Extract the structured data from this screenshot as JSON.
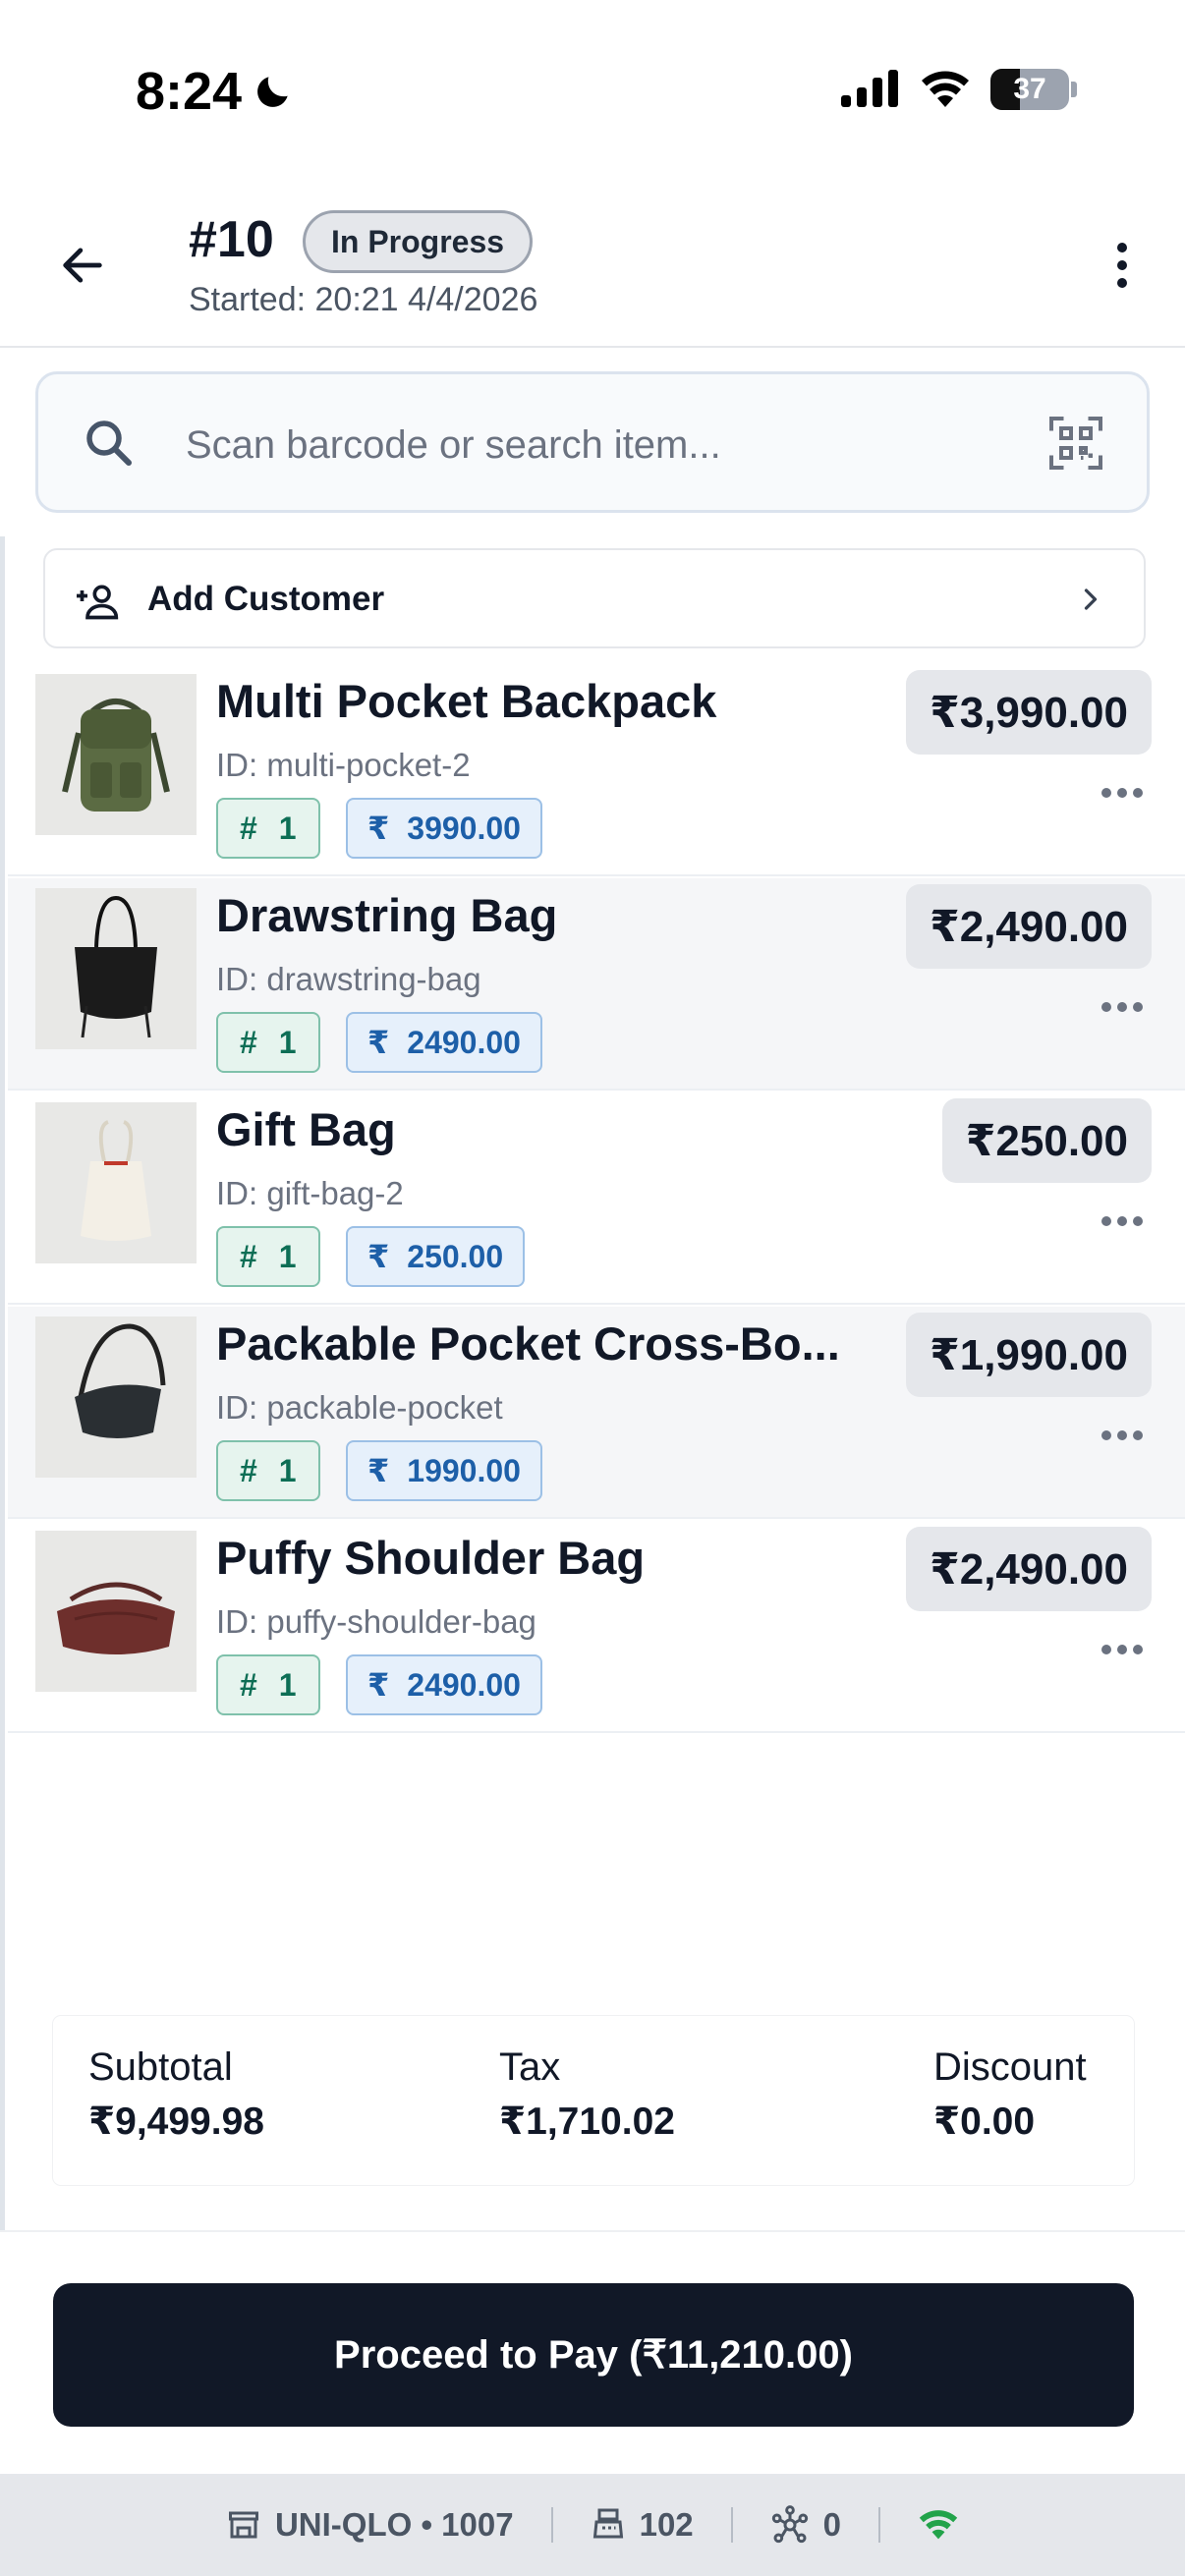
{
  "status_bar": {
    "time": "8:24",
    "battery": "37",
    "battery_level": 0.37
  },
  "header": {
    "order_number": "#10",
    "status": "In Progress",
    "started": "Started: 20:21 4/4/2026"
  },
  "search": {
    "placeholder": "Scan barcode or search item..."
  },
  "customer": {
    "label": "Add Customer"
  },
  "items": [
    {
      "name": "Multi Pocket Backpack",
      "id_label": "ID: multi-pocket-2",
      "qty_symbol": "#",
      "qty": "1",
      "currency": "₹",
      "unit_price": "3990.00",
      "line_total": "₹3,990.00",
      "image": "backpack-olive"
    },
    {
      "name": "Drawstring Bag",
      "id_label": "ID: drawstring-bag",
      "qty_symbol": "#",
      "qty": "1",
      "currency": "₹",
      "unit_price": "2490.00",
      "line_total": "₹2,490.00",
      "image": "tote-black"
    },
    {
      "name": "Gift Bag",
      "id_label": "ID: gift-bag-2",
      "qty_symbol": "#",
      "qty": "1",
      "currency": "₹",
      "unit_price": "250.00",
      "line_total": "₹250.00",
      "image": "giftbag-cream"
    },
    {
      "name": "Packable Pocket Cross-Bo...",
      "id_label": "ID: packable-pocket",
      "qty_symbol": "#",
      "qty": "1",
      "currency": "₹",
      "unit_price": "1990.00",
      "line_total": "₹1,990.00",
      "image": "crossbody-black"
    },
    {
      "name": "Puffy Shoulder Bag",
      "id_label": "ID: puffy-shoulder-bag",
      "qty_symbol": "#",
      "qty": "1",
      "currency": "₹",
      "unit_price": "2490.00",
      "line_total": "₹2,490.00",
      "image": "shoulderbag-maroon"
    }
  ],
  "totals": {
    "subtotal_label": "Subtotal",
    "subtotal": "₹9,499.98",
    "tax_label": "Tax",
    "tax": "₹1,710.02",
    "discount_label": "Discount",
    "discount": "₹0.00"
  },
  "pay_button": {
    "label": "Proceed to Pay (₹11,210.00)"
  },
  "footer": {
    "store": "UNI-QLO • 1007",
    "register": "102",
    "connections": "0"
  },
  "colors": {
    "accent": "#111827",
    "qty_chip": "#0d6e55",
    "price_chip": "#1d5fa8",
    "wifi_ok": "#22a34a"
  }
}
